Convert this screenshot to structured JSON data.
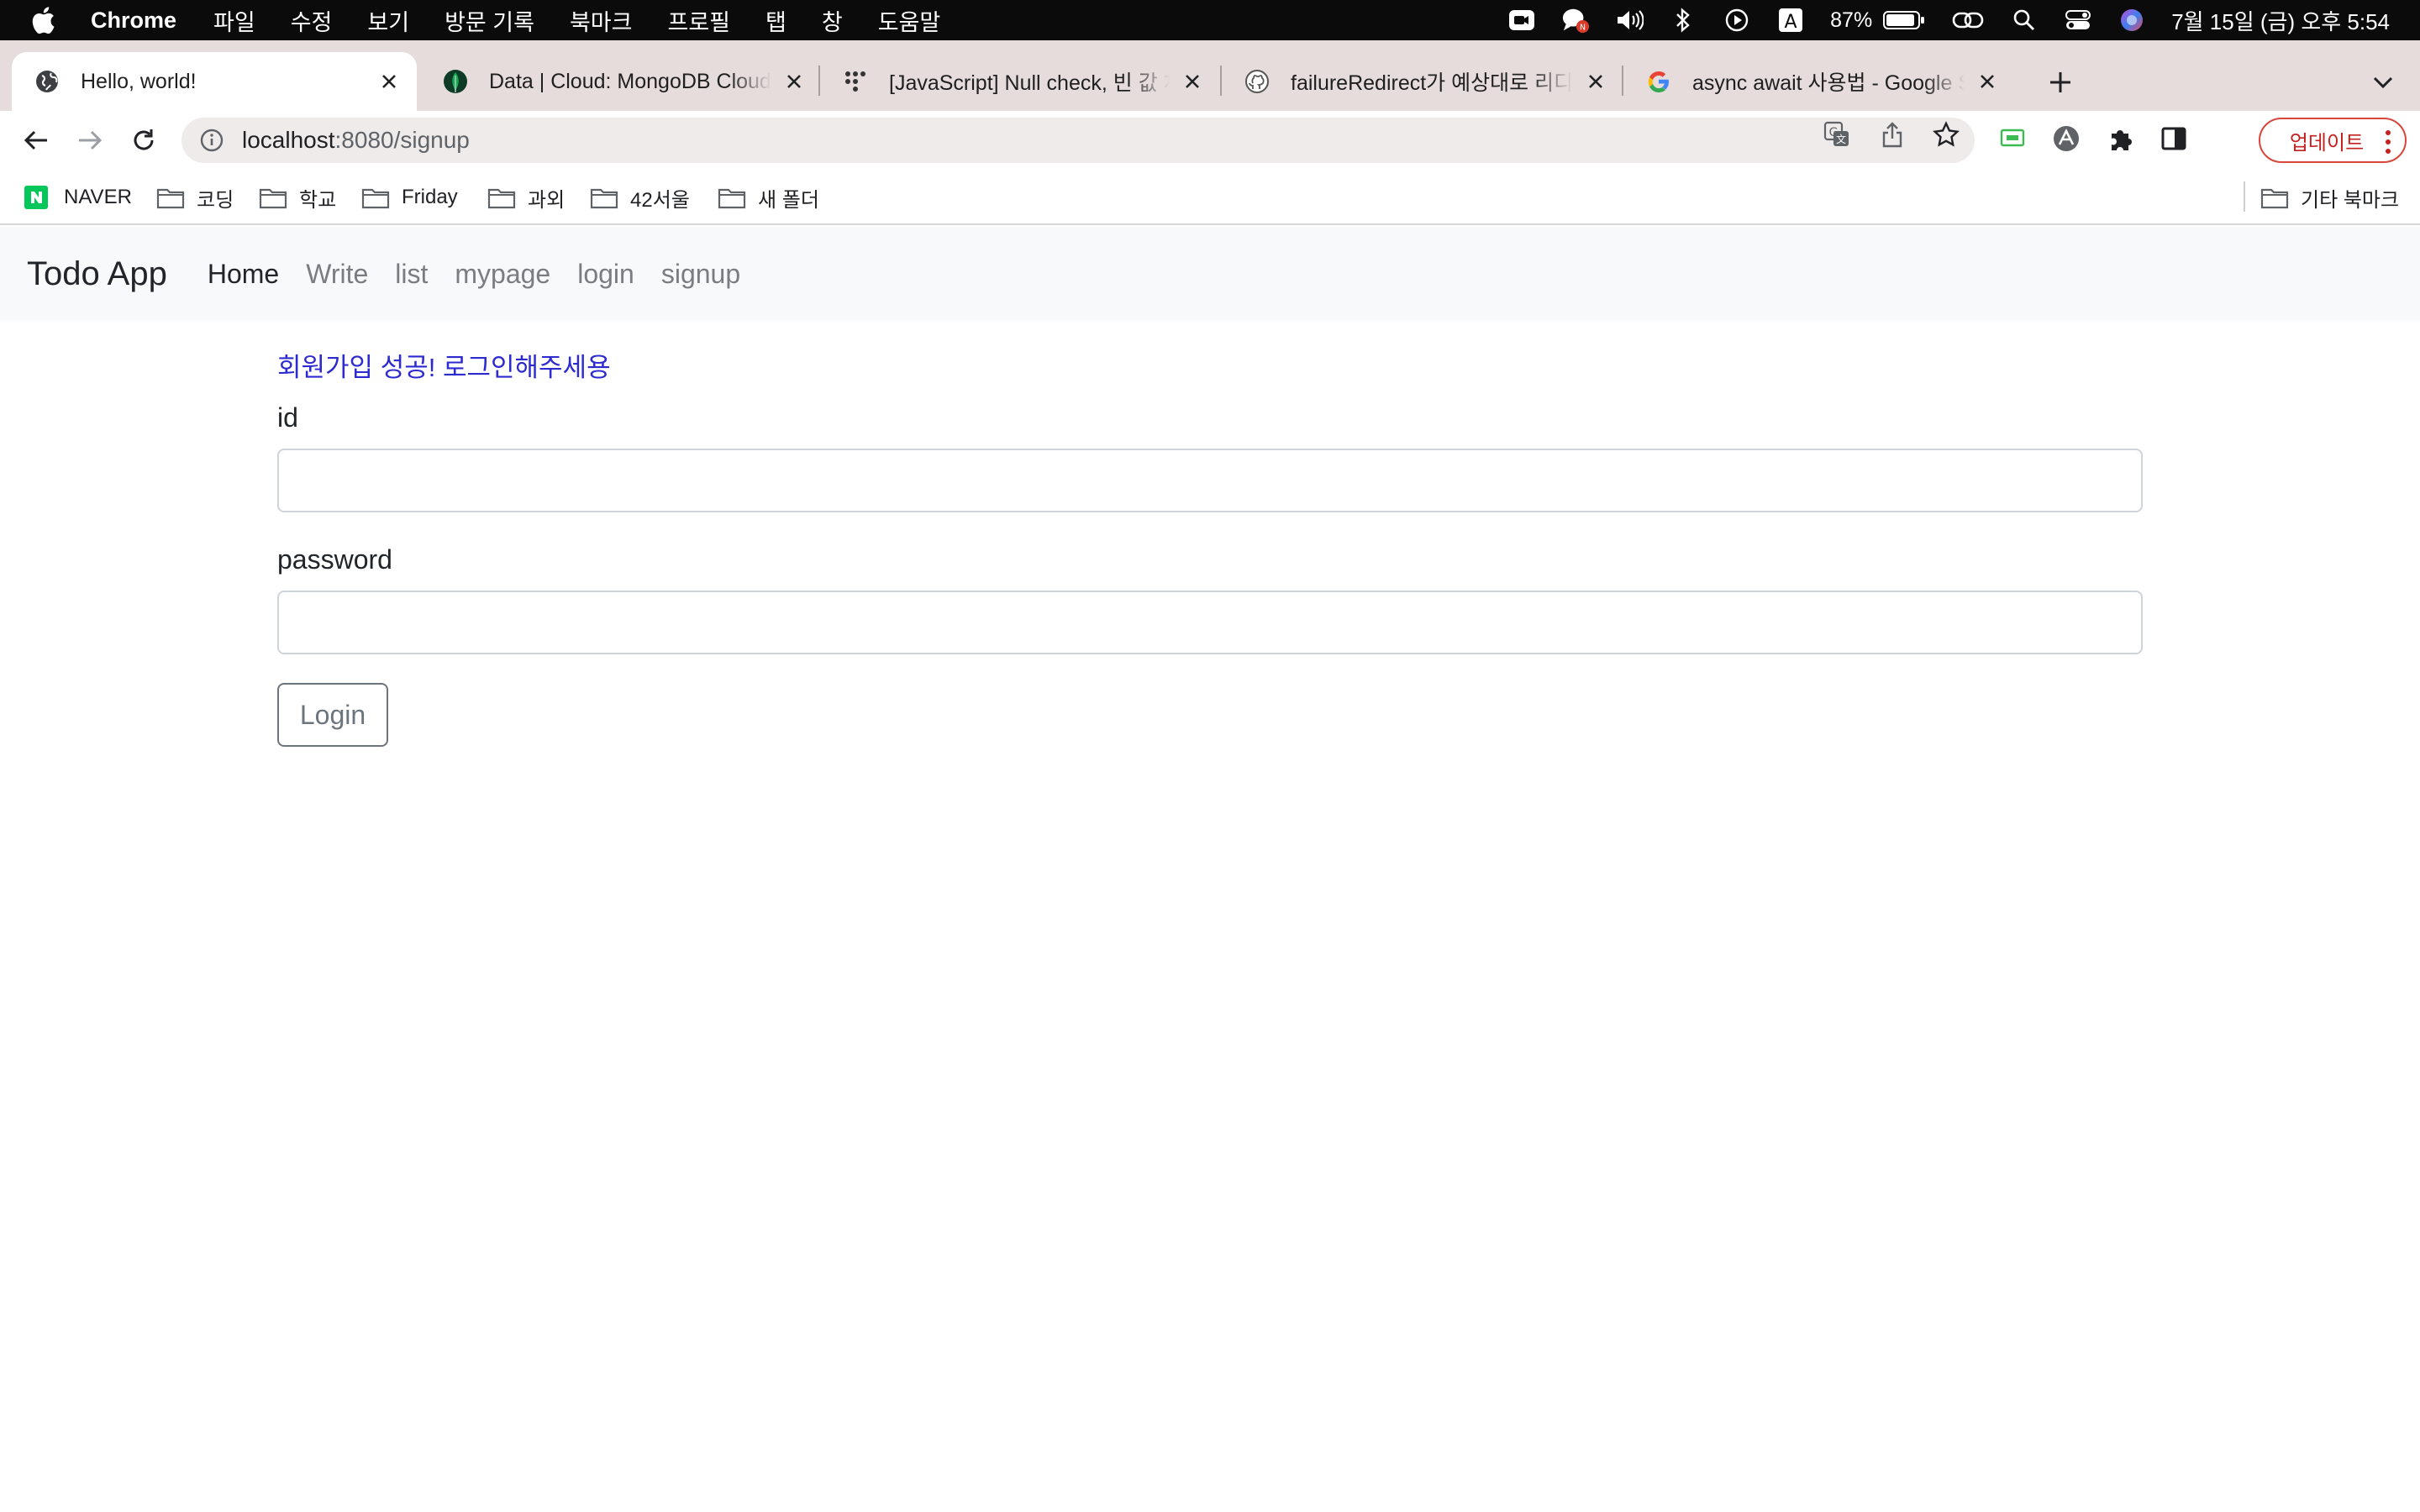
{
  "menubar": {
    "app_name": "Chrome",
    "items": [
      "파일",
      "수정",
      "보기",
      "방문 기록",
      "북마크",
      "프로필",
      "탭",
      "창",
      "도움말"
    ],
    "battery": "87%",
    "clock": "7월 15일 (금) 오후 5:54",
    "status_icons": [
      "camera-icon",
      "chat-icon",
      "volume-icon",
      "bluetooth-icon",
      "play-icon",
      "input-source-icon",
      "battery-icon",
      "link-icon",
      "search-icon",
      "control-center-icon",
      "siri-icon"
    ]
  },
  "tabs": [
    {
      "title": "Hello, world!",
      "icon": "globe-icon",
      "active": true
    },
    {
      "title": "Data | Cloud: MongoDB Cloud",
      "icon": "mongodb-leaf-icon"
    },
    {
      "title": "[JavaScript] Null check, 빈 값 체크",
      "icon": "dots-icon"
    },
    {
      "title": "failureRedirect가 예상대로 리디렉트",
      "icon": "github-icon"
    },
    {
      "title": "async await 사용법 - Google Search",
      "icon": "google-icon"
    }
  ],
  "toolbar": {
    "url_host": "localhost",
    "url_path": ":8080/signup",
    "update_label": "업데이트"
  },
  "bookmarks": {
    "items": [
      {
        "label": "NAVER",
        "icon": "naver-icon"
      },
      {
        "label": "코딩",
        "icon": "folder-icon"
      },
      {
        "label": "학교",
        "icon": "folder-icon"
      },
      {
        "label": "Friday",
        "icon": "folder-icon"
      },
      {
        "label": "과외",
        "icon": "folder-icon"
      },
      {
        "label": "42서울",
        "icon": "folder-icon"
      },
      {
        "label": "새 폴더",
        "icon": "folder-icon"
      }
    ],
    "other": "기타 북마크"
  },
  "page": {
    "brand": "Todo App",
    "nav": [
      "Home",
      "Write",
      "list",
      "mypage",
      "login",
      "signup"
    ],
    "flash_message": "회원가입 성공! 로그인해주세용",
    "id_label": "id",
    "id_value": "",
    "password_label": "password",
    "password_value": "",
    "login_button": "Login"
  },
  "colors": {
    "tabstrip": "#e6dcdc",
    "navbar_bg": "#f8f9fa",
    "flash_text": "#2d2bcf",
    "update_border": "#d9453b"
  }
}
